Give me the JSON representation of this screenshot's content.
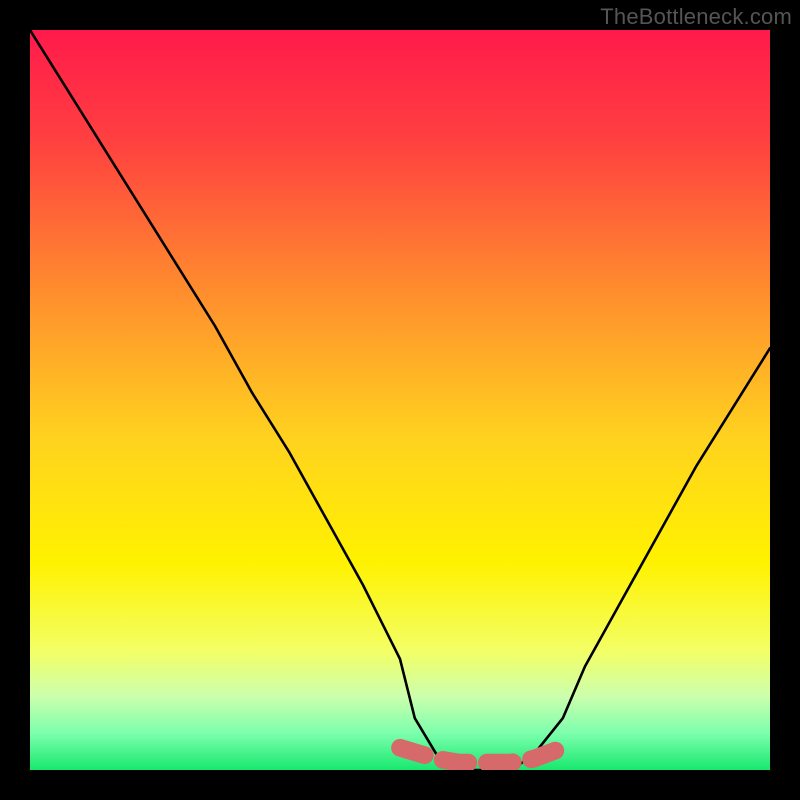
{
  "watermark": "TheBottleneck.com",
  "chart_data": {
    "type": "line",
    "title": "",
    "xlabel": "",
    "ylabel": "",
    "xlim": [
      0,
      100
    ],
    "ylim": [
      0,
      100
    ],
    "grid": false,
    "legend": false,
    "series": [
      {
        "name": "bottleneck-curve",
        "x": [
          0,
          5,
          10,
          15,
          20,
          25,
          30,
          35,
          40,
          45,
          50,
          52,
          55,
          58,
          62,
          65,
          68,
          72,
          75,
          80,
          85,
          90,
          95,
          100
        ],
        "y": [
          100,
          92,
          84,
          76,
          68,
          60,
          51,
          43,
          34,
          25,
          15,
          7,
          2,
          0,
          0,
          0,
          2,
          7,
          14,
          23,
          32,
          41,
          49,
          57
        ]
      },
      {
        "name": "optimal-band",
        "x": [
          50,
          55,
          58,
          62,
          65,
          68,
          72
        ],
        "y": [
          3,
          1.5,
          1,
          1,
          1,
          1.5,
          3
        ]
      }
    ],
    "gradient_stops": [
      {
        "pos": 0.0,
        "color": "#ff1a4b"
      },
      {
        "pos": 0.15,
        "color": "#ff4040"
      },
      {
        "pos": 0.35,
        "color": "#ff8c2e"
      },
      {
        "pos": 0.55,
        "color": "#ffd21f"
      },
      {
        "pos": 0.72,
        "color": "#fff200"
      },
      {
        "pos": 0.84,
        "color": "#f3ff66"
      },
      {
        "pos": 0.9,
        "color": "#ccffad"
      },
      {
        "pos": 0.95,
        "color": "#7dffad"
      },
      {
        "pos": 1.0,
        "color": "#17e86f"
      }
    ],
    "colors": {
      "curve": "#000000",
      "band": "#d66a6a",
      "frame": "#000000"
    }
  }
}
